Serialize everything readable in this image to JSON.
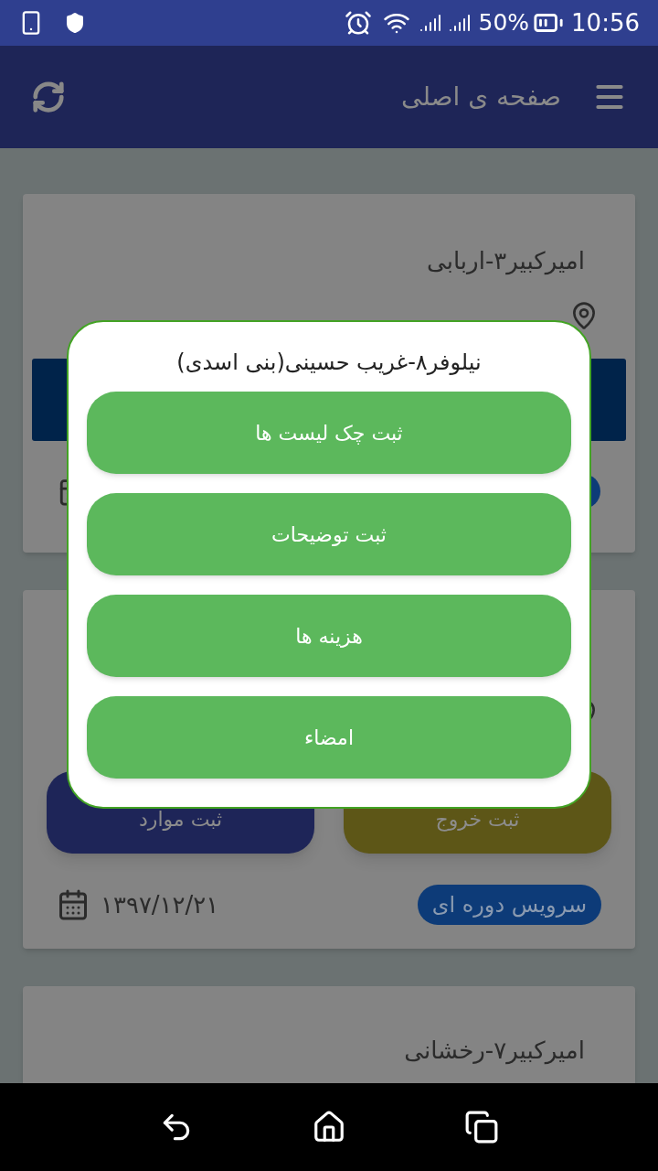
{
  "status_bar": {
    "battery": "50%",
    "time": "10:56"
  },
  "app_bar": {
    "title": "صفحه ی اصلی"
  },
  "cards": [
    {
      "title": "امیرکبیر۳-اربابی"
    },
    {
      "buttons": [
        {
          "label": "ثبت خروج",
          "kind": "exit"
        },
        {
          "label": "ثبت موارد",
          "kind": "items"
        }
      ],
      "badge": "سرویس دوره ای",
      "date": "۱۳۹۷/۱۲/۲۱"
    },
    {
      "title": "امیرکبیر۷-رخشانی"
    }
  ],
  "dialog": {
    "title": "نیلوفر۸-غریب حسینی(بنی اسدی)",
    "buttons": [
      "ثبت چک لیست ها",
      "ثبت توضیحات",
      "هزینه ها",
      "امضاء"
    ]
  }
}
